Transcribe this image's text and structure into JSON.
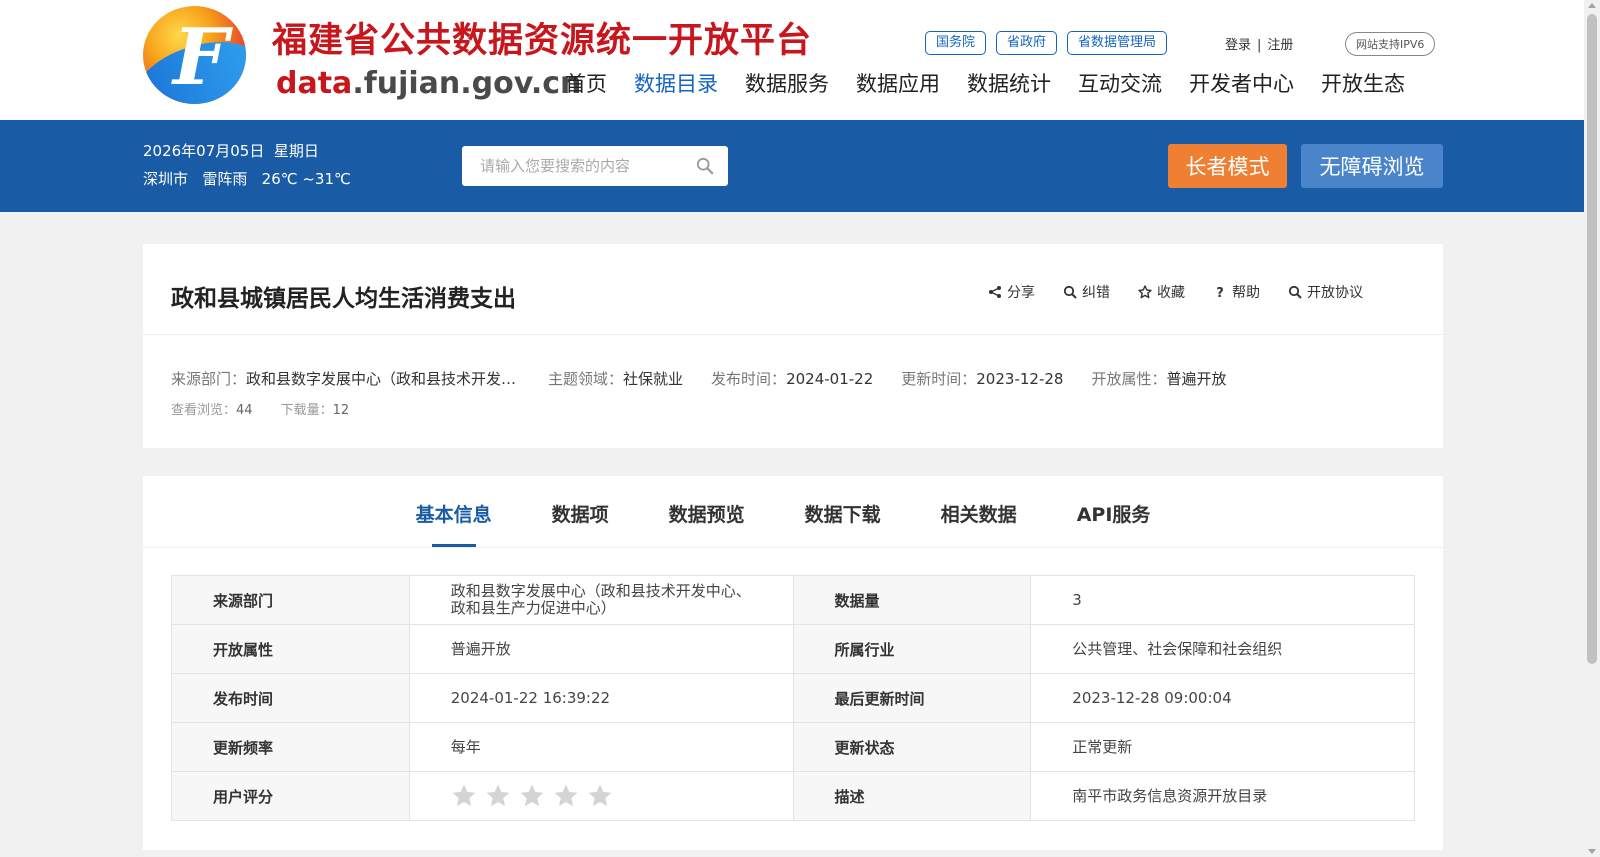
{
  "header": {
    "site_title": "福建省公共数据资源统一开放平台",
    "domain_part1": "data",
    "domain_part2": ".fujian.gov.cn",
    "top_links": [
      "国务院",
      "省政府",
      "省数据管理局"
    ],
    "login": "登录",
    "separator": "|",
    "register": "注册",
    "ipv6_badge": "网站支持IPV6",
    "nav": [
      "首页",
      "数据目录",
      "数据服务",
      "数据应用",
      "数据统计",
      "互动交流",
      "开发者中心",
      "开放生态"
    ],
    "active_nav_index": 1
  },
  "banner": {
    "date": "2026年07月05日",
    "weekday": "星期日",
    "city": "深圳市",
    "weather": "雷阵雨",
    "temperature": "26℃ ~31℃",
    "search_placeholder": "请输入您要搜索的内容",
    "elder_mode": "长者模式",
    "accessible": "无障碍浏览"
  },
  "dataset": {
    "title": "政和县城镇居民人均生活消费支出",
    "actions": [
      "分享",
      "纠错",
      "收藏",
      "帮助",
      "开放协议"
    ],
    "meta": {
      "source_label": "来源部门：",
      "source_value": "政和县数字发展中心（政和县技术开发中心、政和县生产力促进中心）",
      "topic_label": "主题领域：",
      "topic_value": "社保就业",
      "publish_label": "发布时间：",
      "publish_value": "2024-01-22",
      "update_label": "更新时间：",
      "update_value": "2023-12-28",
      "open_label": "开放属性：",
      "open_value": "普遍开放"
    },
    "stats": {
      "views_label": "查看浏览：",
      "views": "44",
      "downloads_label": "下载量：",
      "downloads": "12"
    }
  },
  "tabs": [
    "基本信息",
    "数据项",
    "数据预览",
    "数据下载",
    "相关数据",
    "API服务"
  ],
  "active_tab_index": 0,
  "info_table": [
    {
      "k1": "来源部门",
      "v1": "政和县数字发展中心（政和县技术开发中心、政和县生产力促进中心）",
      "k2": "数据量",
      "v2": "3"
    },
    {
      "k1": "开放属性",
      "v1": "普遍开放",
      "k2": "所属行业",
      "v2": "公共管理、社会保障和社会组织"
    },
    {
      "k1": "发布时间",
      "v1": "2024-01-22 16:39:22",
      "k2": "最后更新时间",
      "v2": "2023-12-28 09:00:04"
    },
    {
      "k1": "更新频率",
      "v1": "每年",
      "k2": "更新状态",
      "v2": "正常更新"
    },
    {
      "k1": "用户评分",
      "v1": "",
      "k2": "描述",
      "v2": "南平市政务信息资源开放目录"
    }
  ],
  "rating": {
    "value": 0,
    "max": 5
  },
  "colors": {
    "brand_blue": "#1a5ba6",
    "brand_red": "#c8161d",
    "elder_orange": "#ef7f33",
    "accessible_blue": "#4a85cc",
    "star_empty": "#d4d4d4"
  }
}
